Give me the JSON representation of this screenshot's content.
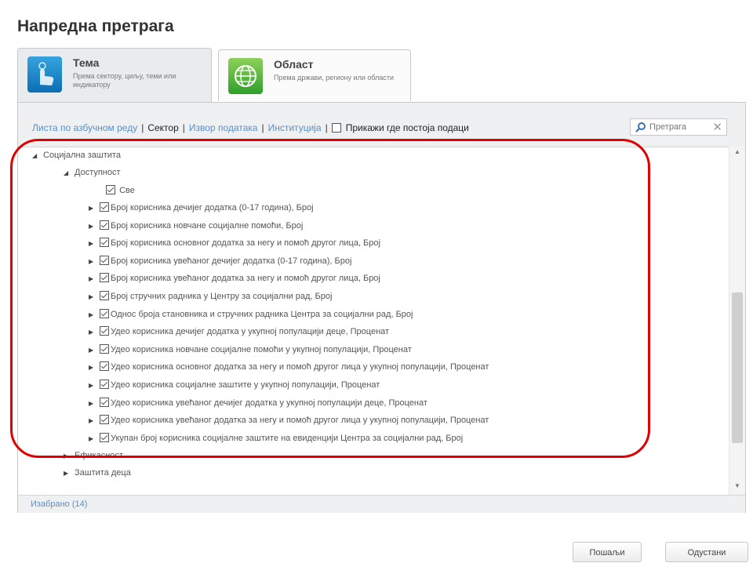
{
  "page": {
    "title": "Напредна претрага"
  },
  "tabs": [
    {
      "title": "Тема",
      "subtitle": "Према сектору, циљу, теми или индикатору",
      "icon": "hand-topic-icon"
    },
    {
      "title": "Област",
      "subtitle": "Према држави, региону или области",
      "icon": "globe-icon"
    }
  ],
  "filters": {
    "alphabetical": "Листа по азбучном реду",
    "sector": "Сектор",
    "data_source": "Извор података",
    "institution": "Институција",
    "only_with_data": "Прикажи где постоја подаци",
    "separator": "|"
  },
  "search": {
    "placeholder": "Претрага",
    "clear": "✕"
  },
  "tree": {
    "root": "Социјална заштита",
    "group": "Доступност",
    "all": "Све",
    "items": [
      "Број корисника дечијег додатка (0-17 година), Број",
      "Број корисника новчане социјалне помоћи, Број",
      "Број корисника основног додатка за негу и помоћ другог лица, Број",
      "Број корисника увећаног дечијег додатка (0-17 година), Број",
      "Број корисника увећаног додатка за негу и помоћ другог лица, Број",
      "Број стручних радника у Центру за социјални рад, Број",
      "Однос броја становника и стручних радника Центра за социјални рад, Број",
      "Удео корисника дечијег додатка у укупној популацији деце, Проценат",
      "Удео корисника новчане социјалне помоћи у укупној популацији, Проценат",
      "Удео корисника основног додатка за негу и помоћ другог лица у укупној популацији, Проценат",
      "Удео корисника социјалне заштите у укупној популацији, Проценат",
      "Удео корисника увећаног дечијег додатка у укупној популацији деце, Проценат",
      "Удео корисника увећаног додатка за негу и помоћ другог лица у укупној популацији, Проценат",
      "Укупан број корисника социјалне заштите на евиденцији Центра за социјални рад, Број"
    ],
    "siblings": [
      "Ефикасност",
      "Заштита деца"
    ]
  },
  "footer": {
    "selected": "Изабрано (14)"
  },
  "buttons": {
    "send": "Пошаљи",
    "cancel": "Одустани"
  },
  "colors": {
    "link": "#5a8fc8",
    "highlight": "#e00000"
  }
}
